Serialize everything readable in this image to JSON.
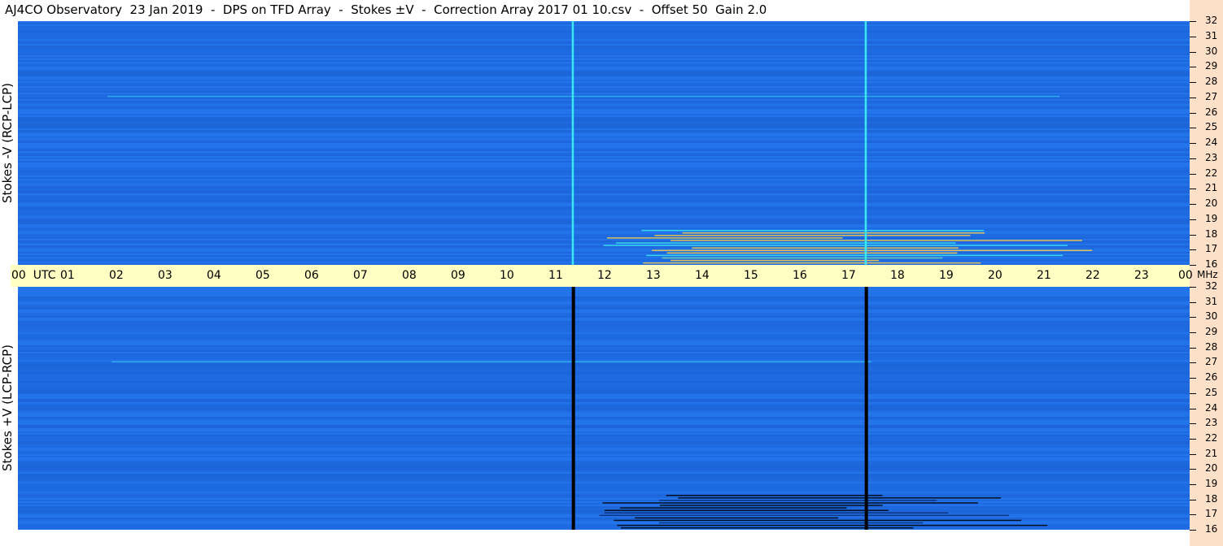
{
  "title": "AJ4CO Observatory  23 Jan 2019  -  DPS on TFD Array  -  Stokes ±V  -  Correction Array 2017 01 10.csv  -  Offset 50  Gain 2.0",
  "colors": {
    "background": "#1f6fe6",
    "time_axis_bg": "#ffffc4",
    "right_strip_bg": "#fde0c8",
    "interference_bright": "#39e8f0",
    "interference_dark": "#000000",
    "hot": "#ffd040"
  },
  "time_axis": {
    "labels": [
      "00  UTC",
      "01",
      "02",
      "03",
      "04",
      "05",
      "06",
      "07",
      "08",
      "09",
      "10",
      "11",
      "12",
      "13",
      "14",
      "15",
      "16",
      "17",
      "18",
      "19",
      "20",
      "21",
      "22",
      "23",
      "00"
    ]
  },
  "freq_unit": "MHz",
  "chart_data": [
    {
      "type": "heatmap",
      "panel": "top",
      "ylabel": "Stokes -V (RCP-LCP)",
      "x_unit": "UTC hour",
      "xlim": [
        0,
        24
      ],
      "y_unit": "MHz",
      "ylim": [
        16,
        32
      ],
      "yticks": [
        32,
        31,
        30,
        29,
        28,
        27,
        26,
        25,
        24,
        23,
        22,
        21,
        20,
        19,
        18,
        17,
        16
      ],
      "vertical_lines": [
        {
          "time_utc": 11.37,
          "style": "bright"
        },
        {
          "time_utc": 17.37,
          "style": "bright"
        }
      ],
      "features": [
        {
          "time_start": 11.8,
          "time_end": 22.0,
          "freq_start": 16.0,
          "freq_end": 18.3,
          "style": "hot"
        },
        {
          "time_start": 0.1,
          "time_end": 23.9,
          "freq_start": 26.9,
          "freq_end": 27.1,
          "style": "bright"
        }
      ]
    },
    {
      "type": "heatmap",
      "panel": "bottom",
      "ylabel": "Stokes +V (LCP-RCP)",
      "x_unit": "UTC hour",
      "xlim": [
        0,
        24
      ],
      "y_unit": "MHz",
      "ylim": [
        16,
        32
      ],
      "yticks": [
        32,
        31,
        30,
        29,
        28,
        27,
        26,
        25,
        24,
        23,
        22,
        21,
        20,
        19,
        18,
        17,
        16
      ],
      "vertical_lines": [
        {
          "time_utc": 11.37,
          "style": "dark"
        },
        {
          "time_utc": 17.37,
          "style": "dark"
        }
      ],
      "features": [
        {
          "time_start": 11.8,
          "time_end": 22.0,
          "freq_start": 16.0,
          "freq_end": 18.3,
          "style": "dark"
        },
        {
          "time_start": 0.1,
          "time_end": 23.9,
          "freq_start": 26.9,
          "freq_end": 27.1,
          "style": "bright"
        }
      ]
    }
  ]
}
